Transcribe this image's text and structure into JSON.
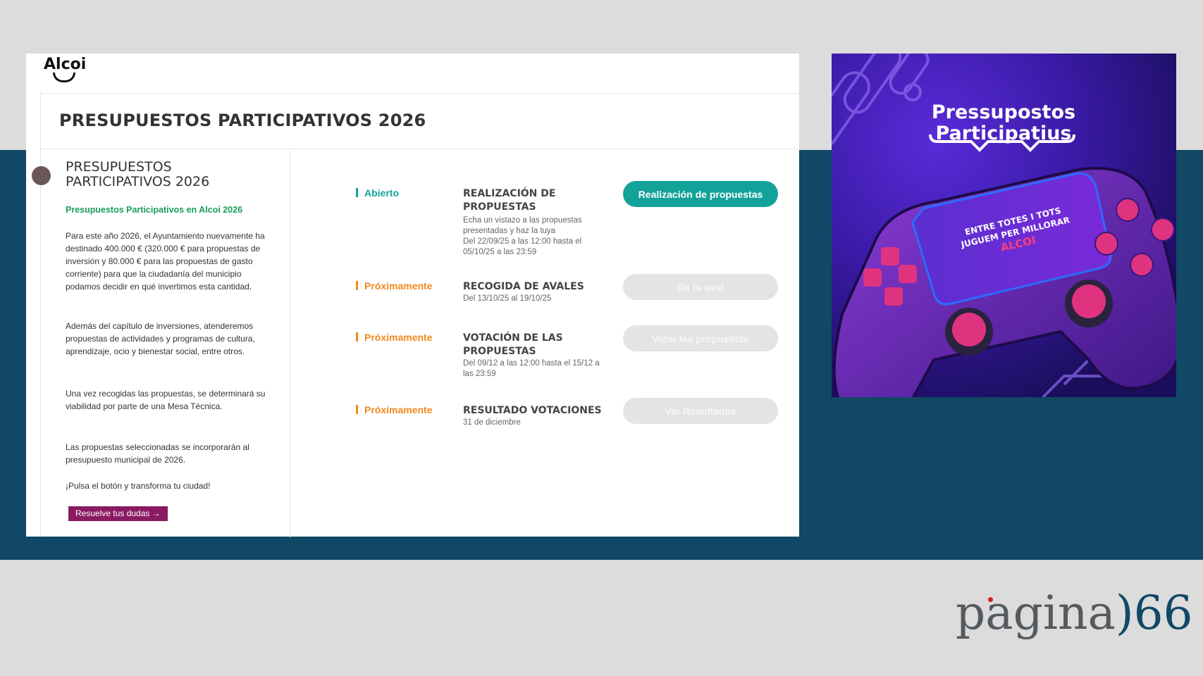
{
  "site": {
    "logo_text": "Alcoi",
    "page_title": "PRESUPUESTOS PARTICIPATIVOS 2026",
    "left": {
      "title_line1": "PRESUPUESTOS",
      "title_line2": "PARTICIPATIVOS 2026",
      "subtitle": "Presupuestos Participativos en Alcoi 2026",
      "paragraphs": [
        "Para este año 2026, el Ayuntamiento nuevamente ha destinado 400.000 € (320.000 € para propuestas de inversión y 80.000 € para las propuestas de gasto corriente) para que la ciudadanía del municipio podamos decidir en qué invertimos esta cantidad.",
        "Además del capítulo de inversiones, atenderemos propuestas de actividades y programas de cultura, aprendizaje, ocio y bienestar social, entre otros.",
        "Una vez recogidas las propuestas, se determinará su viabilidad por parte de una Mesa Técnica.",
        "Las propuestas seleccionadas se incorporarán al presupuesto municipal de 2026.",
        "¡Pulsa el botón y transforma tu ciudad!"
      ],
      "dudas_button": "Resuelve tus dudas →"
    },
    "phases": [
      {
        "status": "Abierto",
        "title": "REALIZACIÓN DE PROPUESTAS",
        "desc1": "Echa un vistazo a las propuestas presentadas y haz la tuya",
        "desc2": "Del 22/09/25 a las 12:00 hasta el 05/10/25 a las 23:59",
        "button": "Realización de propuestas"
      },
      {
        "status": "Próximamente",
        "title": "RECOGIDA DE AVALES",
        "desc1": "Del 13/10/25 al 19/10/25",
        "button": "Da tu aval"
      },
      {
        "status": "Próximamente",
        "title": "VOTACIÓN DE LAS PROPUESTAS",
        "desc1": "Del 09/12 a las 12:00 hasta el 15/12 a las 23:59",
        "button": "Votar las propuestas"
      },
      {
        "status": "Próximamente",
        "title": "RESULTADO VOTACIONES",
        "desc1": "31 de diciembre",
        "button": "Ver Resultados"
      }
    ]
  },
  "poster": {
    "title_line1": "Pressupostos",
    "title_line2": "Participatius",
    "screen_line1": "ENTRE TOTES I TOTS",
    "screen_line2": "JUGUEM PER MILLORAR",
    "screen_line3": "ALCOI"
  },
  "watermark": {
    "word": "pagina",
    "paren": ")",
    "number": "66"
  },
  "colors": {
    "band": "#114866",
    "accent_teal": "#12a29a",
    "accent_orange": "#f0891d",
    "accent_green": "#1a9e5a",
    "accent_purple": "#8a1a62"
  }
}
